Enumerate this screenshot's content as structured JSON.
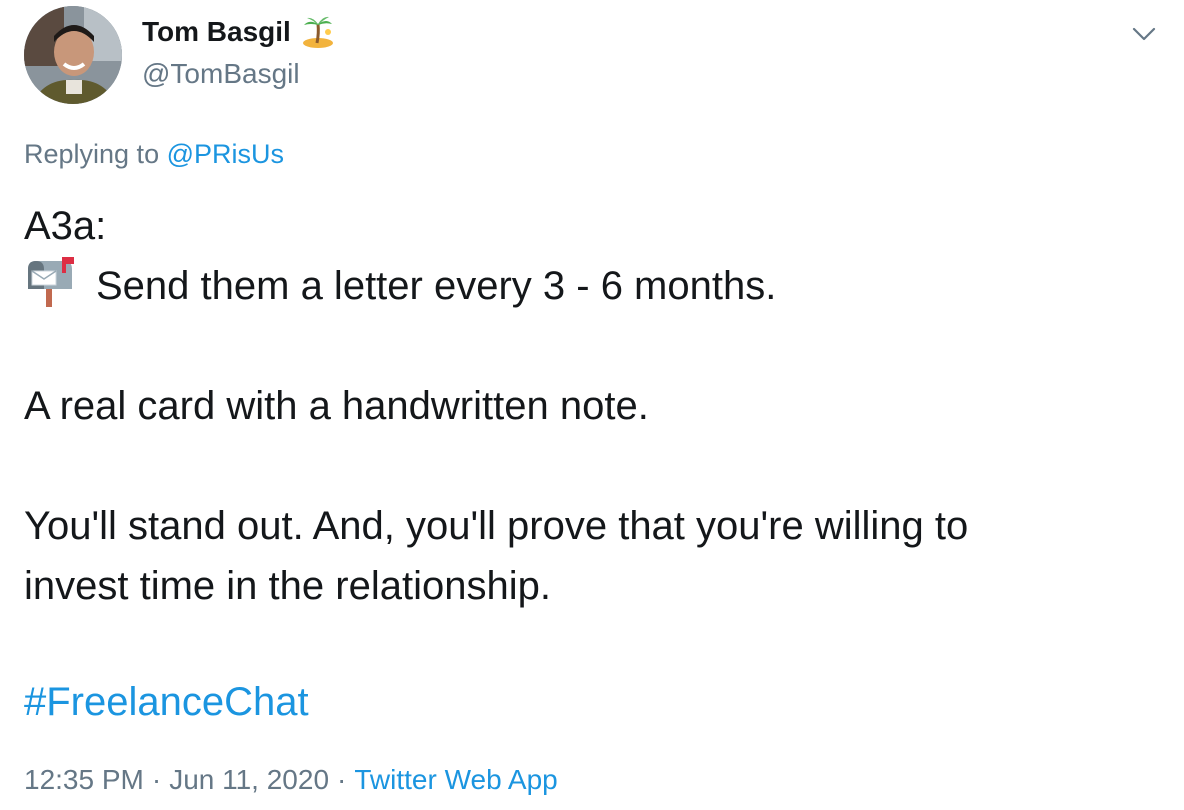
{
  "tweet": {
    "author": {
      "display_name": "Tom Basgil",
      "name_emoji": "island-palm-tree-emoji",
      "handle": "@TomBasgil",
      "avatar": "profile-photo"
    },
    "menu_icon": "chevron-down-icon",
    "replying_to_label": "Replying to",
    "replying_to_mention": "@PRisUs",
    "body": {
      "line1": "A3a:",
      "line2_icon": "mailbox-icon",
      "line2": "Send them a letter every 3 - 6 months.",
      "paragraph2": "A real card with a handwritten note.",
      "paragraph3_line1": "You'll stand out. And, you'll prove that you're willing to",
      "paragraph3_line2": "invest time in the relationship."
    },
    "hashtag": "#FreelanceChat",
    "meta": {
      "time": "12:35 PM",
      "separator": "·",
      "date": "Jun 11, 2020",
      "source": "Twitter Web App"
    }
  }
}
